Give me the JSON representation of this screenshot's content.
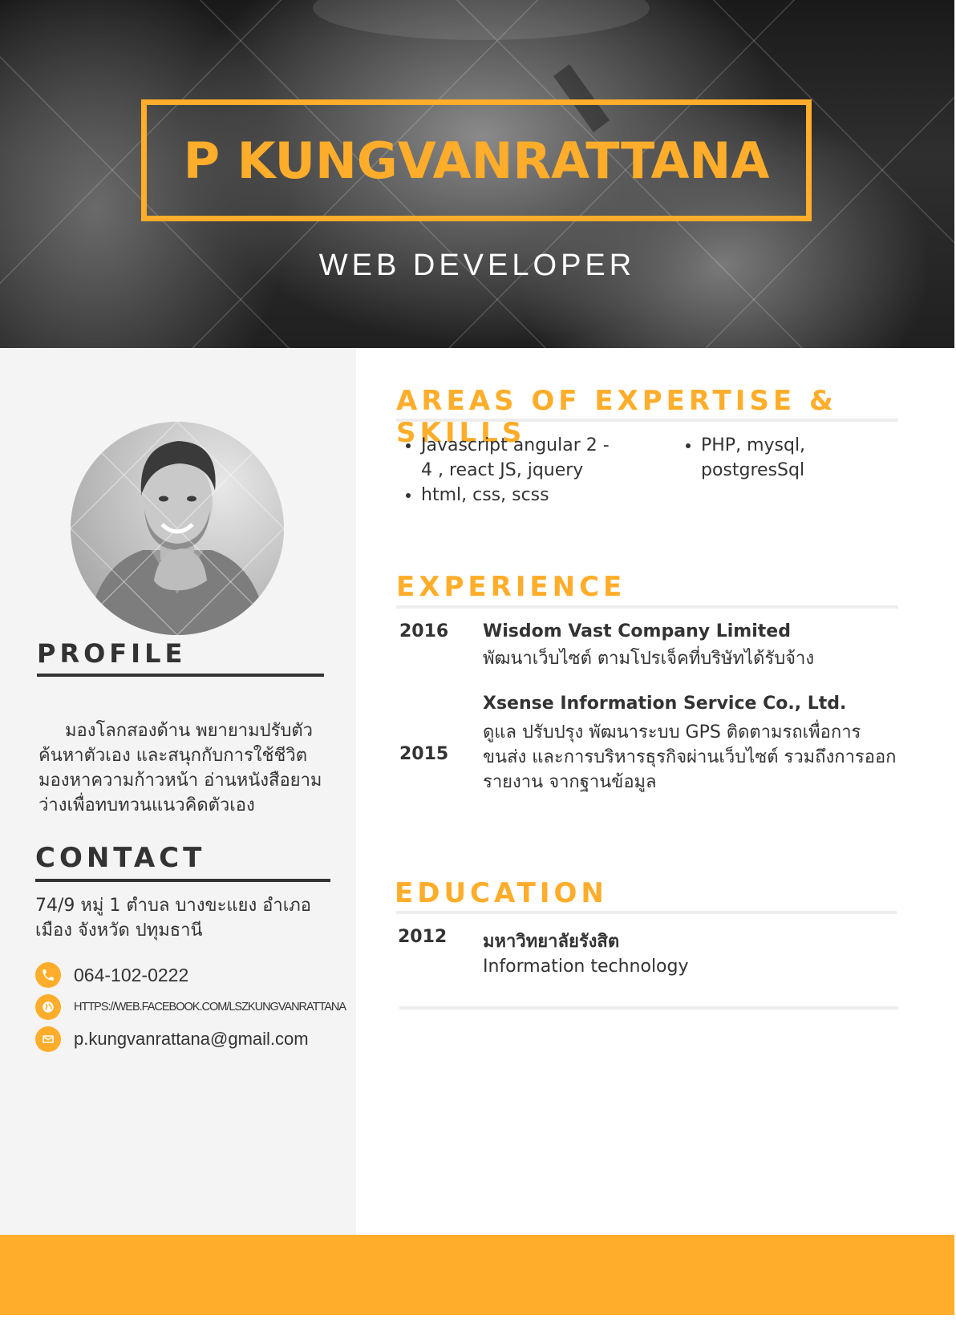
{
  "header": {
    "name": "P KUNGVANRATTANA",
    "title": "WEB DEVELOPER"
  },
  "colors": {
    "accent": "#FFAD2A",
    "dark_text": "#333333",
    "left_panel_bg": "#F4F4F4",
    "rule": "#EDEDED"
  },
  "profile": {
    "heading": "PROFILE",
    "text": "มองโลกสองด้าน พยายามปรับตัว ค้นหาตัวเอง และสนุกกับการใช้ชีวิต มองหาความก้าวหน้า  อ่านหนังสือยามว่างเพื่อทบทวนแนวคิดตัวเอง"
  },
  "contact": {
    "heading": "CONTACT",
    "address": "74/9 หมู่ 1 ตำบล บางขะแยง อำเภอ เมือง จังหวัด ปทุมธานี",
    "phone": "064-102-0222",
    "website": "HTTPS://WEB.FACEBOOK.COM/LSZKUNGVANRATTANA",
    "email": "p.kungvanrattana@gmail.com",
    "icons": [
      "phone-icon",
      "globe-icon",
      "mail-icon"
    ]
  },
  "skills": {
    "heading": "AREAS OF EXPERTISE & SKILLS",
    "column1": [
      "Javascript angular 2 - 4 , react JS, jquery",
      "html, css, scss"
    ],
    "column2": [
      "PHP, mysql, postgresSql"
    ]
  },
  "experience": {
    "heading": "EXPERIENCE",
    "items": [
      {
        "year": "2016",
        "company": "Wisdom Vast Company Limited",
        "description": "พัฒนาเว็บไซต์ ตามโปรเจ็คที่บริษัทได้รับจ้าง"
      },
      {
        "year": "2015",
        "company": "Xsense Information Service Co., Ltd.",
        "description": "ดูแล ปรับปรุง พัฒนาระบบ GPS ติดตามรถเพื่อการขนส่ง และการบริหารธุรกิจผ่านเว็บไซต์ รวมถึงการออกรายงาน จากฐานข้อมูล"
      }
    ]
  },
  "education": {
    "heading": "EDUCATION",
    "items": [
      {
        "year": "2012",
        "institution": "มหาวิทยาลัยรังสิต",
        "field": "Information technology"
      }
    ]
  }
}
